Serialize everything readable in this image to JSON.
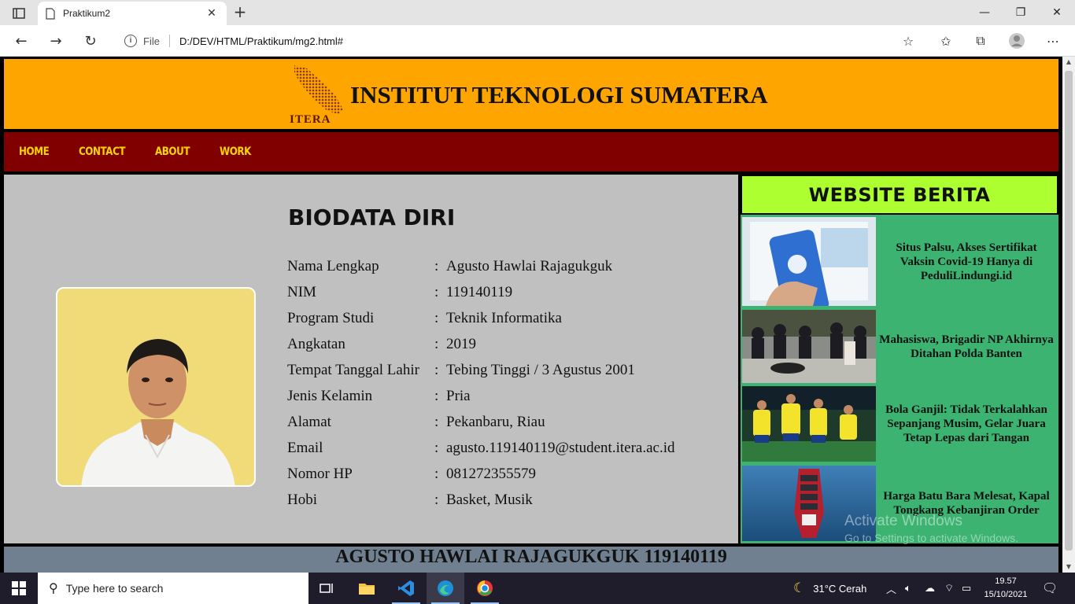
{
  "browser": {
    "tab_title": "Praktikum2",
    "address_prefix": "File",
    "url": "D:/DEV/HTML/Praktikum/mg2.html#"
  },
  "header": {
    "logo_text": "ITERA",
    "title": "INSTITUT TEKNOLOGI SUMATERA",
    "color": "#ffa500"
  },
  "nav": {
    "items": [
      "HOME",
      "CONTACT",
      "ABOUT",
      "WORK"
    ],
    "color": "#800000",
    "text_color": "#ffd700"
  },
  "biodata": {
    "title": "BIODATA DIRI",
    "rows": [
      {
        "label": "Nama Lengkap",
        "value": "Agusto Hawlai Rajagukguk"
      },
      {
        "label": "NIM",
        "value": "119140119"
      },
      {
        "label": "Program Studi",
        "value": "Teknik Informatika"
      },
      {
        "label": "Angkatan",
        "value": "2019"
      },
      {
        "label": "Tempat Tanggal Lahir",
        "value": "Tebing Tinggi / 3 Agustus 2001"
      },
      {
        "label": "Jenis Kelamin",
        "value": "Pria"
      },
      {
        "label": "Alamat",
        "value": "Pekanbaru, Riau"
      },
      {
        "label": "Email",
        "value": "agusto.119140119@student.itera.ac.id"
      },
      {
        "label": "Nomor HP",
        "value": "081272355579"
      },
      {
        "label": "Hobi",
        "value": "Basket, Musik"
      }
    ],
    "separator": ":"
  },
  "sidebar": {
    "title": "WEBSITE BERITA",
    "news": [
      {
        "headline": "Situs Palsu, Akses Sertifikat Vaksin Covid-19 Hanya di PeduliLindungi.id",
        "image": "pedulilindungi-phone"
      },
      {
        "headline": "Mahasiswa, Brigadir NP Akhirnya Ditahan Polda Banten",
        "image": "police-crowd"
      },
      {
        "headline": "Bola Ganjil: Tidak Terkalahkan Sepanjang Musim, Gelar Juara Tetap Lepas dari Tangan",
        "image": "football-celebration"
      },
      {
        "headline": "Harga Batu Bara Melesat, Kapal Tongkang Kebanjiran Order",
        "image": "cargo-ship"
      }
    ]
  },
  "footer": {
    "text": "AGUSTO HAWLAI RAJAGUKGUK 119140119"
  },
  "watermark": {
    "line1": "Activate Windows",
    "line2": "Go to Settings to activate Windows."
  },
  "taskbar": {
    "search_placeholder": "Type here to search",
    "weather": "31°C  Cerah",
    "time": "19.57",
    "date": "15/10/2021"
  }
}
